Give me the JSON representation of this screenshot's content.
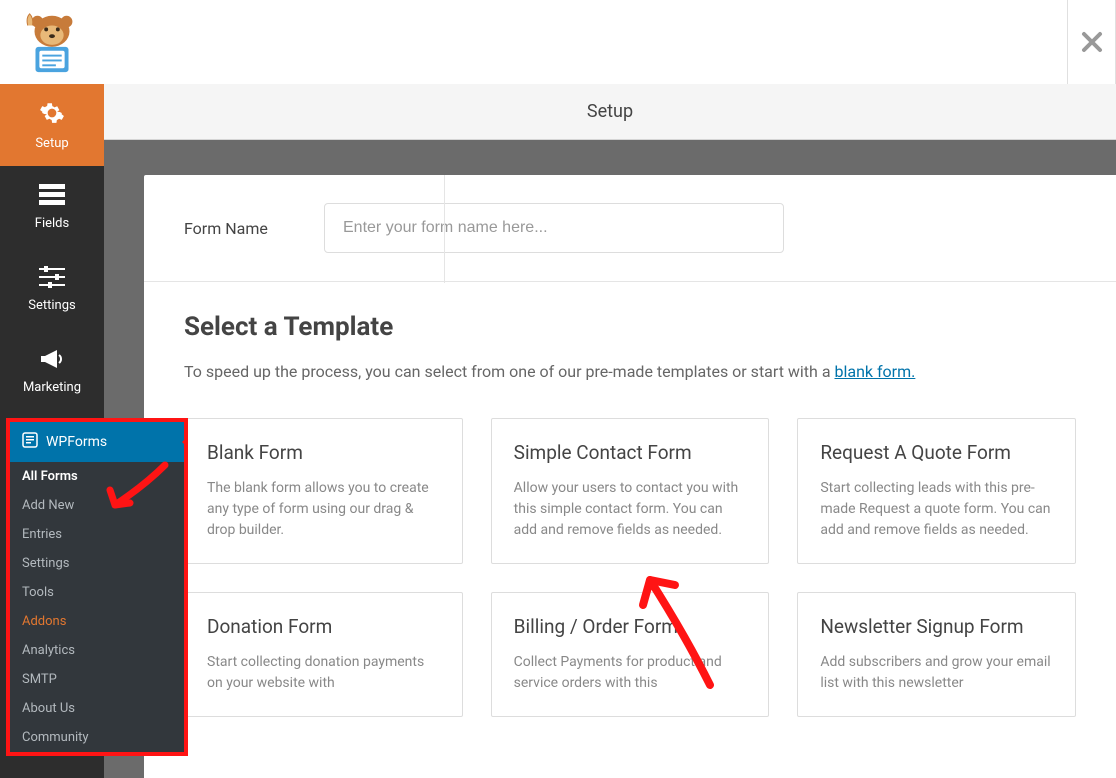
{
  "header": {
    "page_title": "Setup"
  },
  "sidebar": {
    "items": [
      {
        "label": "Setup",
        "icon": "gear"
      },
      {
        "label": "Fields",
        "icon": "list"
      },
      {
        "label": "Settings",
        "icon": "sliders"
      },
      {
        "label": "Marketing",
        "icon": "bullhorn"
      }
    ]
  },
  "form_name": {
    "label": "Form Name",
    "placeholder": "Enter your form name here...",
    "value": ""
  },
  "templates": {
    "heading": "Select a Template",
    "subtext_prefix": "To speed up the process, you can select from one of our pre-made templates or start with a ",
    "subtext_link": "blank form.",
    "cards": [
      {
        "title": "Blank Form",
        "desc": "The blank form allows you to create any type of form using our drag & drop builder."
      },
      {
        "title": "Simple Contact Form",
        "desc": "Allow your users to contact you with this simple contact form. You can add and remove fields as needed."
      },
      {
        "title": "Request A Quote Form",
        "desc": "Start collecting leads with this pre-made Request a quote form. You can add and remove fields as needed."
      },
      {
        "title": "Donation Form",
        "desc": "Start collecting donation payments on your website with"
      },
      {
        "title": "Billing / Order Form",
        "desc": "Collect Payments for product and service orders with this"
      },
      {
        "title": "Newsletter Signup Form",
        "desc": "Add subscribers and grow your email list with this newsletter"
      }
    ]
  },
  "wp_submenu": {
    "header": "WPForms",
    "items": [
      {
        "label": "All Forms",
        "state": "active"
      },
      {
        "label": "Add New",
        "state": ""
      },
      {
        "label": "Entries",
        "state": ""
      },
      {
        "label": "Settings",
        "state": ""
      },
      {
        "label": "Tools",
        "state": ""
      },
      {
        "label": "Addons",
        "state": "highlight"
      },
      {
        "label": "Analytics",
        "state": ""
      },
      {
        "label": "SMTP",
        "state": ""
      },
      {
        "label": "About Us",
        "state": ""
      },
      {
        "label": "Community",
        "state": ""
      }
    ]
  }
}
